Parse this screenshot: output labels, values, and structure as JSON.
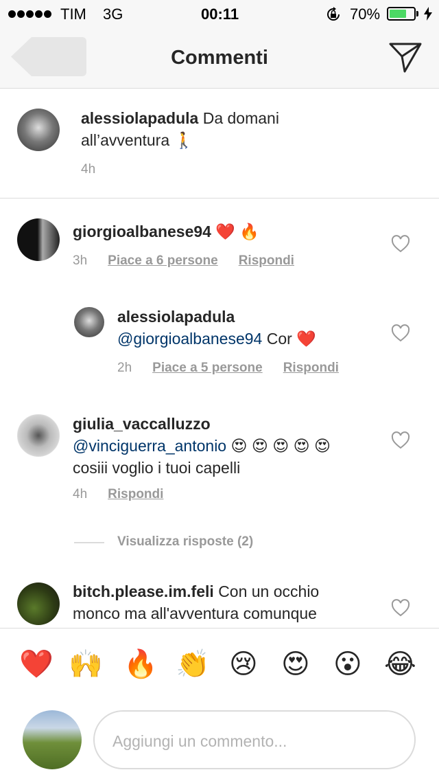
{
  "status_bar": {
    "carrier": "TIM",
    "network": "3G",
    "time": "00:11",
    "battery": "70%",
    "battery_level": 0.7
  },
  "nav": {
    "title": "Commenti"
  },
  "caption": {
    "username": "alessiolapadula",
    "text_line1": "Da domani",
    "text_line2": "all’avventura",
    "emoji": "🚶",
    "time": "4h"
  },
  "comments": [
    {
      "username": "giorgioalbanese94",
      "text": "❤️ 🔥",
      "time": "3h",
      "likes": "Piace a 6 persone",
      "reply": "Rispondi"
    },
    {
      "username": "alessiolapadula",
      "mention": "@giorgioalbanese94",
      "text": "Cor ❤️",
      "time": "2h",
      "likes": "Piace a 5 persone",
      "reply": "Rispondi"
    },
    {
      "username": "giulia_vaccalluzzo",
      "mention": "@vinciguerra_antonio",
      "emojis": "😍 😍 😍 😍 😍",
      "text_line2": "cosiii voglio i tuoi capelli",
      "time": "4h",
      "reply": "Rispondi"
    },
    {
      "username": "bitch.please.im.feli",
      "text_line1": "Con un occhio",
      "text_line2": "monco ma all'avventura comunque"
    }
  ],
  "view_replies": "Visualizza risposte (2)",
  "quick_emojis": [
    "❤️",
    "🙌",
    "🔥",
    "👏",
    "😢",
    "😍",
    "😮",
    "😂"
  ],
  "comment_input": {
    "placeholder": "Aggiungi un commento..."
  },
  "colors": {
    "mention": "#003569",
    "meta": "#999999",
    "battery": "#4cd964"
  }
}
